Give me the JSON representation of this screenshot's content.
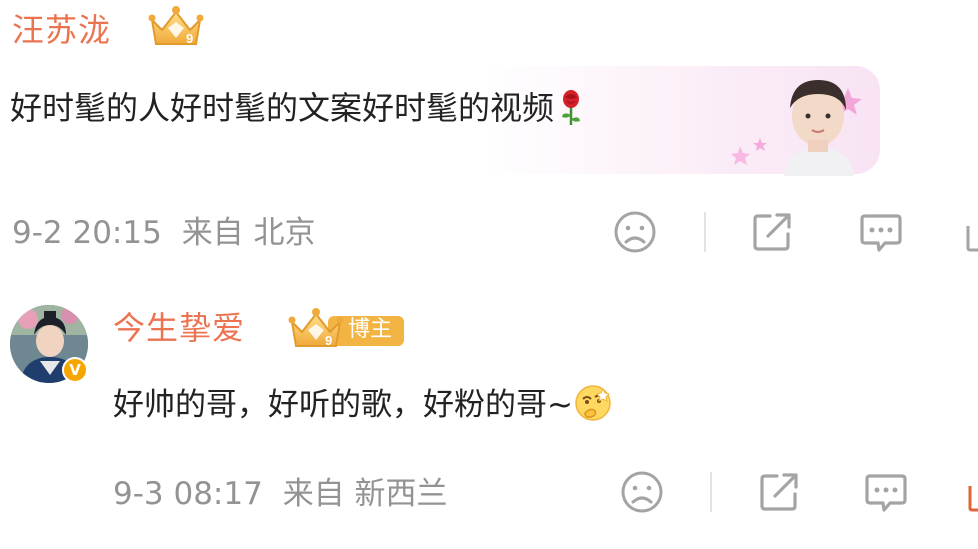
{
  "comments": [
    {
      "author": "汪苏泷",
      "text": "好时髦的人好时髦的文案好时髦的视频",
      "time": "9-2 20:15",
      "location": "来自 北京",
      "badge_level": "9"
    },
    {
      "author": "今生挚爱",
      "text": "好帅的哥，好听的歌，好粉的哥~",
      "time": "9-3 08:17",
      "location": "来自 新西兰",
      "badge_level": "9",
      "role_tag": "博主",
      "verified_mark": "V"
    }
  ],
  "icons": {
    "dislike": "sad-face-icon",
    "share": "share-icon",
    "reply": "comment-icon",
    "like": "like-icon"
  },
  "colors": {
    "author_name": "#eb7350",
    "meta_text": "#939393",
    "icon_gray": "#a4a4a4",
    "badge_gold": "#f2b544"
  }
}
